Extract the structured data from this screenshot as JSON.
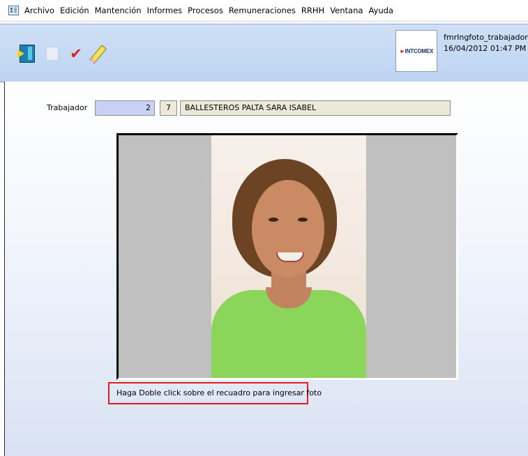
{
  "menu": {
    "items": [
      "Archivo",
      "Edición",
      "Mantención",
      "Informes",
      "Procesos",
      "Remuneraciones",
      "RRHH",
      "Ventana",
      "Ayuda"
    ]
  },
  "toolbar": {
    "buttons": [
      {
        "icon": "exit-door-icon"
      },
      {
        "icon": "disabled-document-icon"
      },
      {
        "icon": "red-check-icon"
      },
      {
        "icon": "pencil-icon"
      }
    ],
    "logo_text": "INTCOMEX",
    "form_name": "fmrIngfoto_trabajador",
    "datetime": "16/04/2012 01:47 PM"
  },
  "form": {
    "worker_label": "Trabajador",
    "worker_number": "2",
    "check_digit": "7",
    "worker_name": "BALLESTEROS PALTA SARA ISABEL",
    "photo_hint": "Haga Doble click sobre el recuadro para ingresar foto"
  },
  "colors": {
    "toolbar_bg": "#bcd4f2",
    "field_highlight": "#c8d2f4",
    "field_readonly": "#ece9d8",
    "hint_border": "#e01e1e"
  }
}
